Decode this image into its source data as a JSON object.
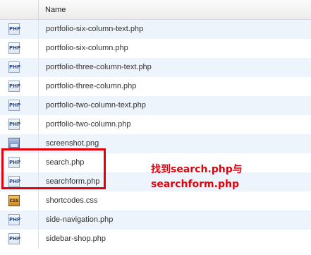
{
  "header": {
    "column_name": "Name"
  },
  "files": [
    {
      "name": "portfolio-six-column-text.php",
      "icon": "php-file-icon"
    },
    {
      "name": "portfolio-six-column.php",
      "icon": "php-file-icon"
    },
    {
      "name": "portfolio-three-column-text.php",
      "icon": "php-file-icon"
    },
    {
      "name": "portfolio-three-column.php",
      "icon": "php-file-icon"
    },
    {
      "name": "portfolio-two-column-text.php",
      "icon": "php-file-icon"
    },
    {
      "name": "portfolio-two-column.php",
      "icon": "php-file-icon"
    },
    {
      "name": "screenshot.png",
      "icon": "image-file-icon"
    },
    {
      "name": "search.php",
      "icon": "php-file-icon"
    },
    {
      "name": "searchform.php",
      "icon": "php-file-icon"
    },
    {
      "name": "shortcodes.css",
      "icon": "css-file-icon"
    },
    {
      "name": "side-navigation.php",
      "icon": "php-file-icon"
    },
    {
      "name": "sidebar-shop.php",
      "icon": "php-file-icon"
    }
  ],
  "icon_labels": {
    "php": "PHP",
    "css": "CSS"
  },
  "annotation": {
    "line1": "找到search.php与",
    "line2": "searchform.php",
    "color": "#e3000b"
  }
}
